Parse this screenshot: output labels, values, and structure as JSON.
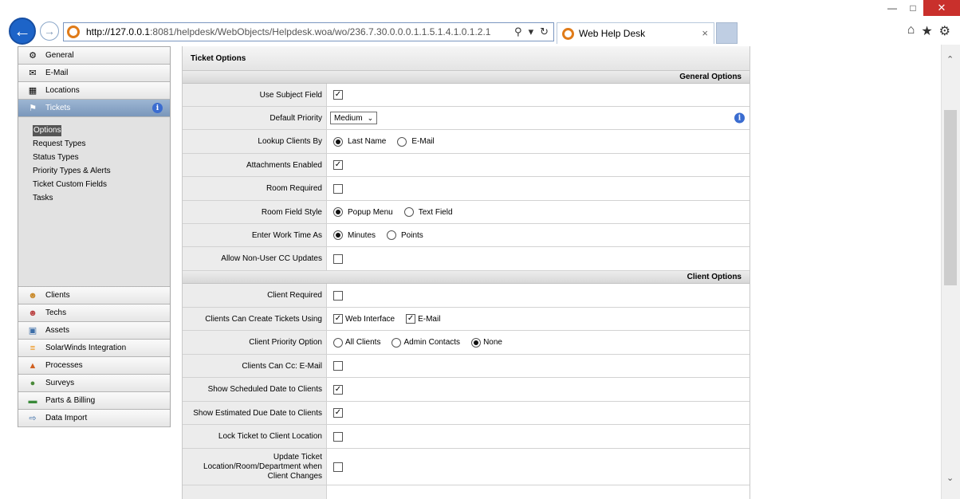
{
  "browser": {
    "url_host": "http://127.0.0.1",
    "url_rest": ":8081/helpdesk/WebObjects/Helpdesk.woa/wo/236.7.30.0.0.0.1.1.5.1.4.1.0.1.2.1",
    "tab_title": "Web Help Desk",
    "tab_close": "×"
  },
  "sidebar": {
    "top_items": [
      {
        "label": "General",
        "icon": "gear-icon"
      },
      {
        "label": "E-Mail",
        "icon": "envelope-icon"
      },
      {
        "label": "Locations",
        "icon": "building-icon"
      },
      {
        "label": "Tickets",
        "icon": "tag-icon"
      }
    ],
    "submenu": [
      "Options",
      "Request Types",
      "Status Types",
      "Priority Types & Alerts",
      "Ticket Custom Fields",
      "Tasks"
    ],
    "bottom_items": [
      {
        "label": "Clients",
        "icon": "client-icon"
      },
      {
        "label": "Techs",
        "icon": "tech-icon"
      },
      {
        "label": "Assets",
        "icon": "monitor-icon"
      },
      {
        "label": "SolarWinds Integration",
        "icon": "solarwinds-icon"
      },
      {
        "label": "Processes",
        "icon": "process-icon"
      },
      {
        "label": "Surveys",
        "icon": "globe-icon"
      },
      {
        "label": "Parts & Billing",
        "icon": "money-icon"
      },
      {
        "label": "Data Import",
        "icon": "import-icon"
      }
    ]
  },
  "main": {
    "title": "Ticket Options",
    "general_header": "General Options",
    "client_header": "Client Options",
    "labels": {
      "use_subject": "Use Subject Field",
      "default_priority": "Default Priority",
      "lookup_clients": "Lookup Clients By",
      "attachments": "Attachments Enabled",
      "room_required": "Room Required",
      "room_field_style": "Room Field Style",
      "work_time": "Enter Work Time As",
      "non_user_cc": "Allow Non-User CC Updates",
      "client_required": "Client Required",
      "clients_create": "Clients Can Create Tickets Using",
      "client_priority": "Client Priority Option",
      "clients_cc": "Clients Can Cc: E-Mail",
      "show_scheduled": "Show Scheduled Date to Clients",
      "show_due": "Show Estimated Due Date to Clients",
      "lock_ticket": "Lock Ticket to Client Location",
      "update_ticket_1": "Update Ticket",
      "update_ticket_2": "Location/Room/Department when",
      "update_ticket_3": "Client Changes"
    },
    "options": {
      "priority_value": "Medium",
      "last_name": "Last Name",
      "email": "E-Mail",
      "popup_menu": "Popup Menu",
      "text_field": "Text Field",
      "minutes": "Minutes",
      "points": "Points",
      "web_interface": "Web Interface",
      "email2": "E-Mail",
      "all_clients": "All Clients",
      "admin_contacts": "Admin Contacts",
      "none": "None"
    },
    "check": "✓"
  }
}
